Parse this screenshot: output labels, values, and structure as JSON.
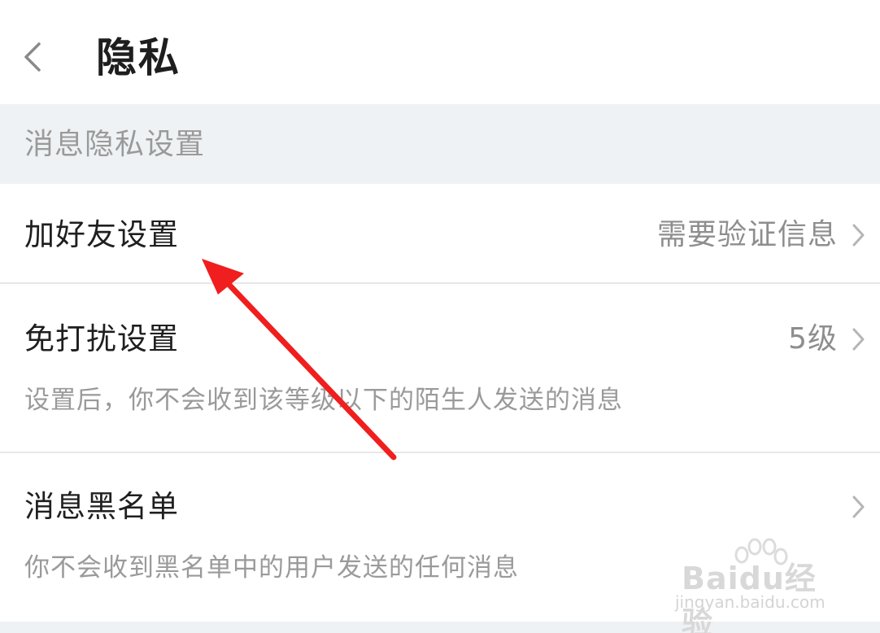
{
  "header": {
    "title": "隐私",
    "back_icon": "chevron-left-icon"
  },
  "section": {
    "title": "消息隐私设置",
    "background": "#eff2f4"
  },
  "rows": [
    {
      "label": "加好友设置",
      "value": "需要验证信息",
      "description": ""
    },
    {
      "label": "免打扰设置",
      "value": "5级",
      "description": "设置后，你不会收到该等级以下的陌生人发送的消息"
    },
    {
      "label": "消息黑名单",
      "value": "",
      "description": "你不会收到黑名单中的用户发送的任何消息"
    }
  ],
  "annotation": {
    "type": "arrow",
    "color": "#f01e1e",
    "points_to": "加好友设置"
  },
  "watermark": {
    "brand": "Baidu经验",
    "url": "jingyan.baidu.com"
  }
}
